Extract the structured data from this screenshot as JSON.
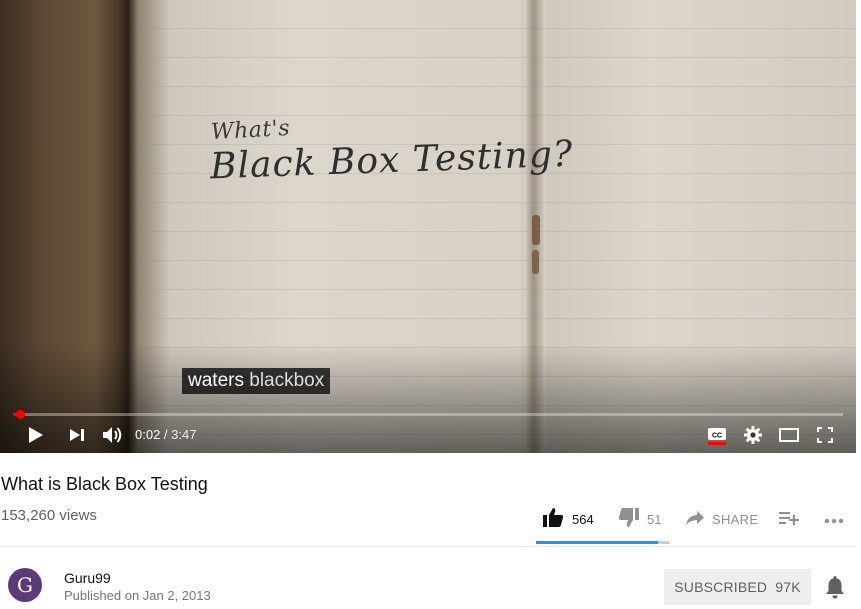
{
  "video": {
    "slide_small": "What's",
    "slide_big": "Black Box Testing?",
    "caption_first": "waters",
    "caption_second": "blackbox",
    "current_time": "0:02",
    "separator": " / ",
    "duration": "3:47",
    "progress_fraction": 0.009
  },
  "controls": {
    "play": "play-icon",
    "next": "next-icon",
    "volume": "volume-icon",
    "captions": "cc-icon",
    "settings": "gear-icon",
    "theater": "theater-icon",
    "fullscreen": "fullscreen-icon"
  },
  "info": {
    "title": "What is Black Box Testing",
    "views": "153,260 views",
    "likes": "564",
    "dislikes": "51",
    "share_label": "SHARE",
    "like_ratio": 0.917
  },
  "channel": {
    "avatar_letter": "G",
    "name": "Guru99",
    "published": "Published on Jan 2, 2013",
    "subscribe_label": "SUBSCRIBED",
    "subscriber_count": "97K"
  },
  "colors": {
    "progress": "#ff0000",
    "sentiment": "#2793e6",
    "avatar": "#5b3a78"
  }
}
